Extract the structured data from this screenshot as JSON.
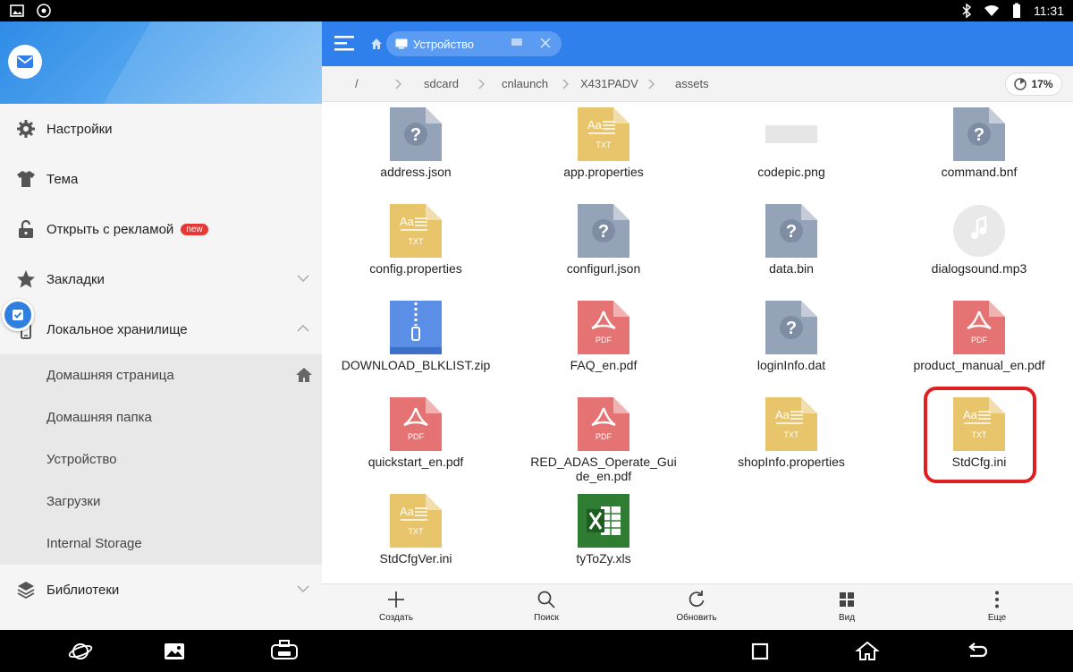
{
  "status_bar": {
    "time": "11:31"
  },
  "drawer": {
    "items": [
      {
        "label": "Настройки",
        "icon": "gear-icon"
      },
      {
        "label": "Тема",
        "icon": "shirt-icon"
      },
      {
        "label": "Открыть с рекламой",
        "icon": "unlock-icon",
        "badge": "new"
      },
      {
        "label": "Закладки",
        "icon": "star-icon"
      },
      {
        "label": "Локальное хранилище",
        "icon": "phone-icon"
      }
    ],
    "sub_items": [
      {
        "label": "Домашняя страница"
      },
      {
        "label": "Домашняя папка"
      },
      {
        "label": "Устройство"
      },
      {
        "label": "Загрузки"
      },
      {
        "label": "Internal Storage"
      }
    ],
    "last_item": {
      "label": "Библиотеки",
      "icon": "layers-icon"
    }
  },
  "appbar": {
    "tab_label": "Устройство"
  },
  "path": {
    "crumbs": [
      "/",
      "sdcard",
      "cnlaunch",
      "X431PADV",
      "assets"
    ],
    "storage_percent": "17%"
  },
  "files": [
    {
      "name": "address.json",
      "type": "unknown"
    },
    {
      "name": "app.properties",
      "type": "txt"
    },
    {
      "name": "codepic.png",
      "type": "image"
    },
    {
      "name": "command.bnf",
      "type": "unknown"
    },
    {
      "name": "config.properties",
      "type": "txt"
    },
    {
      "name": "configurl.json",
      "type": "unknown"
    },
    {
      "name": "data.bin",
      "type": "unknown"
    },
    {
      "name": "dialogsound.mp3",
      "type": "audio"
    },
    {
      "name": "DOWNLOAD_BLKLIST.zip",
      "type": "zip"
    },
    {
      "name": "FAQ_en.pdf",
      "type": "pdf"
    },
    {
      "name": "loginInfo.dat",
      "type": "unknown"
    },
    {
      "name": "product_manual_en.pdf",
      "type": "pdf"
    },
    {
      "name": "quickstart_en.pdf",
      "type": "pdf"
    },
    {
      "name": "RED_ADAS_Operate_Guide_en.pdf",
      "type": "pdf"
    },
    {
      "name": "shopInfo.properties",
      "type": "txt"
    },
    {
      "name": "StdCfg.ini",
      "type": "txt"
    },
    {
      "name": "StdCfgVer.ini",
      "type": "txt"
    },
    {
      "name": "tyToZy.xls",
      "type": "xls"
    }
  ],
  "icon_text": {
    "txt_top": "Aa",
    "txt_bottom": "TXT",
    "pdf": "PDF",
    "unknown": "?"
  },
  "bottom_bar": {
    "create": "Создать",
    "search": "Поиск",
    "refresh": "Обновить",
    "view": "Вид",
    "more": "Еще"
  },
  "colors": {
    "accent": "#2f80ed",
    "txt_icon": "#e8c46a",
    "pdf_icon": "#e57373",
    "unknown_icon": "#95a3b8",
    "zip_icon": "#5b8ee6",
    "xls_icon": "#2e7d32",
    "highlight": "#e02020"
  }
}
